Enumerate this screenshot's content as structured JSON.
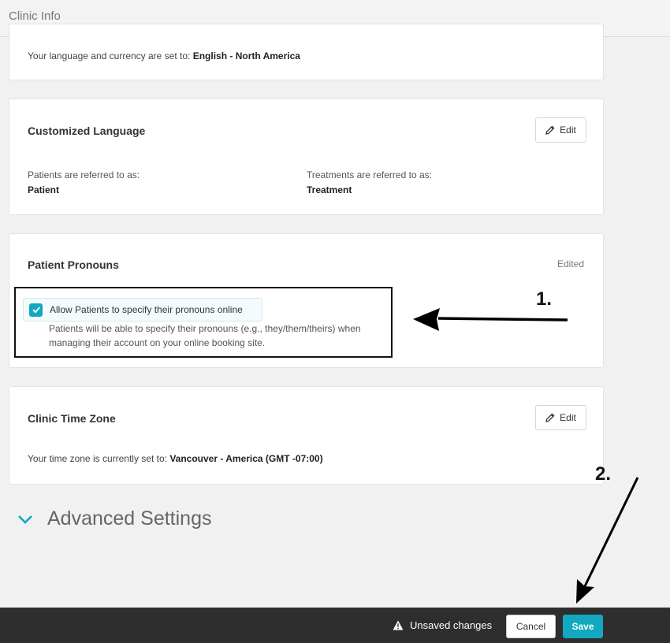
{
  "header": {
    "title": "Clinic Info"
  },
  "language": {
    "text": "Your language and currency are set to: ",
    "value": "English - North America"
  },
  "customized_language": {
    "title": "Customized Language",
    "edit_label": "Edit",
    "patients_label": "Patients are referred to as:",
    "patients_value": "Patient",
    "treatments_label": "Treatments are referred to as:",
    "treatments_value": "Treatment"
  },
  "pronouns": {
    "title": "Patient Pronouns",
    "status": "Edited",
    "checkbox_label": "Allow Patients to specify their pronouns online",
    "checkbox_checked": true,
    "description": "Patients will be able to specify their pronouns (e.g., they/them/theirs) when managing their account on your online booking site."
  },
  "time_zone": {
    "title": "Clinic Time Zone",
    "edit_label": "Edit",
    "text": "Your time zone is currently set to: ",
    "value": "Vancouver - America (GMT -07:00)"
  },
  "advanced": {
    "label": "Advanced Settings"
  },
  "annotations": {
    "step1": "1.",
    "step2": "2."
  },
  "footer": {
    "unsaved": "Unsaved changes",
    "cancel": "Cancel",
    "save": "Save"
  },
  "colors": {
    "accent": "#12a8bf",
    "footer_bg": "#2e2e2e"
  },
  "icons": {
    "edit": "pencil-icon",
    "checkbox": "check-icon",
    "expand": "chevron-down-icon",
    "warning": "warning-icon"
  }
}
